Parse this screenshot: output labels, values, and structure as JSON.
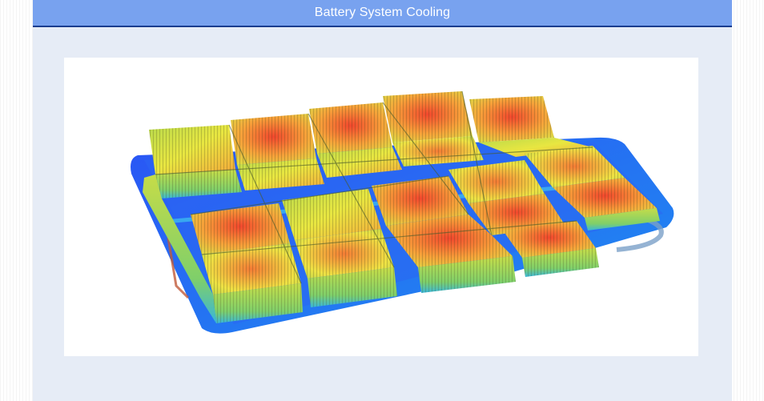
{
  "header": {
    "title": "Battery System Cooling"
  },
  "figure": {
    "subject": "battery-pack-thermal-render",
    "colors": {
      "header_bar": "#78a2ef",
      "header_border": "#1a3d8f",
      "panel_bg": "#e6ecf6",
      "cold_plate": "#1f5bff",
      "cool_cell": "#b9d84a",
      "hot_cell": "#f04a2c"
    }
  }
}
